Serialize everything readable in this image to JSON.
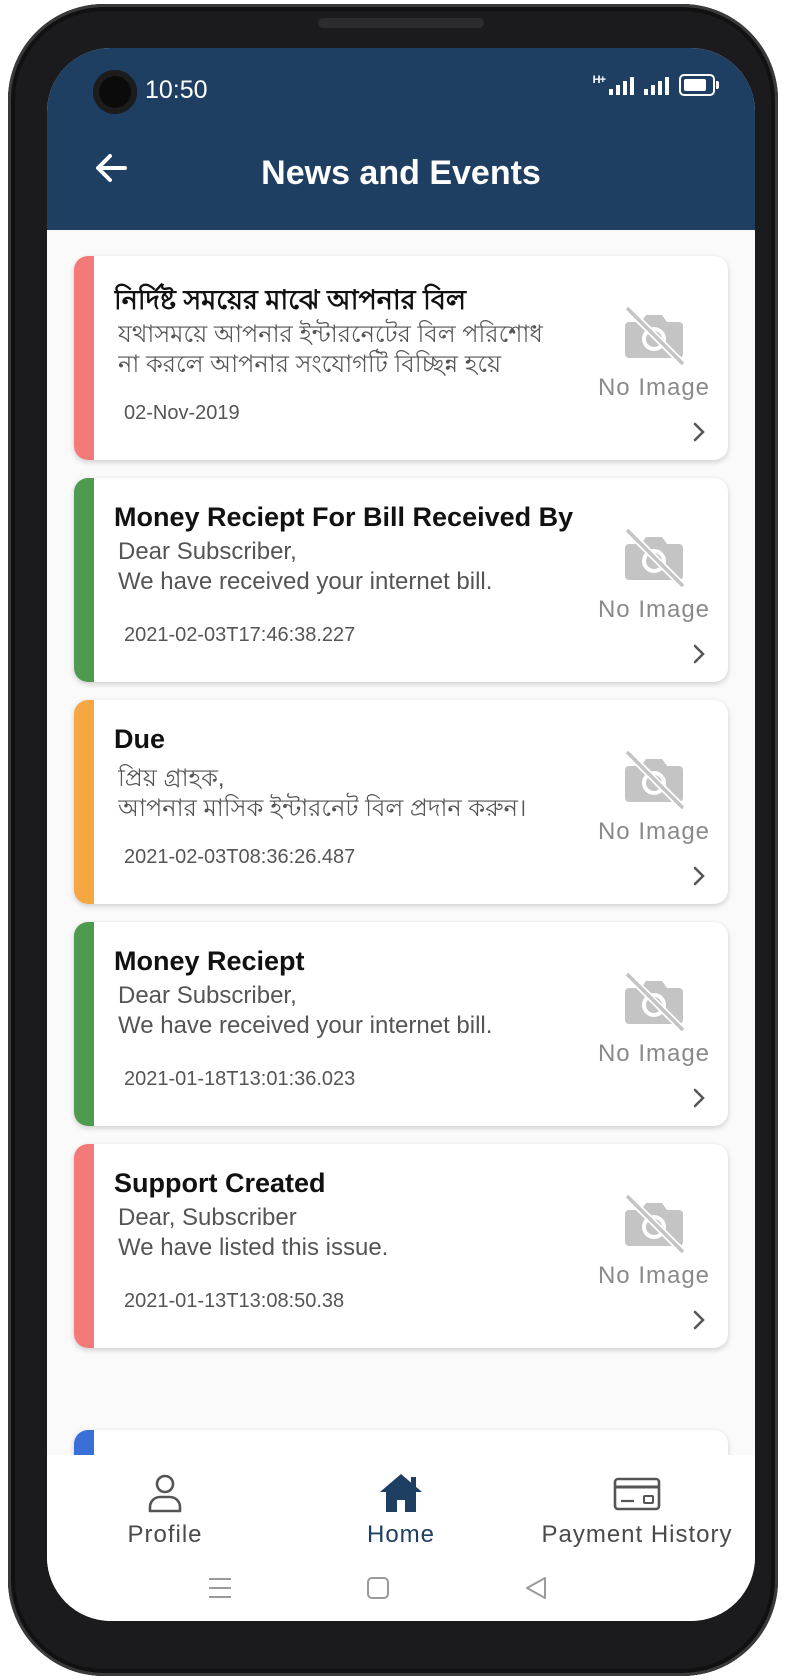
{
  "status_bar": {
    "time": "10:50",
    "network_label": "H+"
  },
  "header": {
    "title": "News and Events",
    "back_icon": "arrow-left-icon"
  },
  "colors": {
    "header_bg": "#1e3f62",
    "stripe_red": "#f47a7a",
    "stripe_green": "#4e9a4e",
    "stripe_orange": "#f5a742",
    "stripe_blue": "#3a6fd8",
    "active_nav": "#1e3f62"
  },
  "news": [
    {
      "title": "নির্দিষ্ট সময়ের মাঝে আপনার  বিল",
      "line1": "যথাসময়ে আপনার ইন্টারনেটের বিল পরিশোধ",
      "line2": "না করলে আপনার সংযোগটি বিচ্ছিন্ন  হয়ে",
      "date": "02-Nov-2019",
      "image_text": "No Image",
      "stripe": "red"
    },
    {
      "title": "Money Reciept For Bill Received By",
      "line1": "Dear Subscriber,",
      "line2": "We have received your internet bill.",
      "date": "2021-02-03T17:46:38.227",
      "image_text": "No Image",
      "stripe": "green"
    },
    {
      "title": "Due",
      "line1": "প্রিয় গ্রাহক,",
      "line2": "আপনার মাসিক ইন্টারনেট বিল প্রদান করুন।",
      "date": "2021-02-03T08:36:26.487",
      "image_text": "No Image",
      "stripe": "orange"
    },
    {
      "title": "Money Reciept",
      "line1": "Dear Subscriber,",
      "line2": "We have received your internet bill.",
      "date": "2021-01-18T13:01:36.023",
      "image_text": "No Image",
      "stripe": "green"
    },
    {
      "title": "Support Created",
      "line1": "Dear, Subscriber",
      "line2": "We have listed this issue.",
      "date": "2021-01-13T13:08:50.38",
      "image_text": "No Image",
      "stripe": "red"
    }
  ],
  "bottom_nav": [
    {
      "label": "Profile",
      "icon": "person-icon",
      "active": false
    },
    {
      "label": "Home",
      "icon": "home-icon",
      "active": true
    },
    {
      "label": "Payment History",
      "icon": "credit-card-icon",
      "active": false
    }
  ],
  "system_nav": [
    "menu-icon",
    "square-home-icon",
    "triangle-back-icon"
  ]
}
